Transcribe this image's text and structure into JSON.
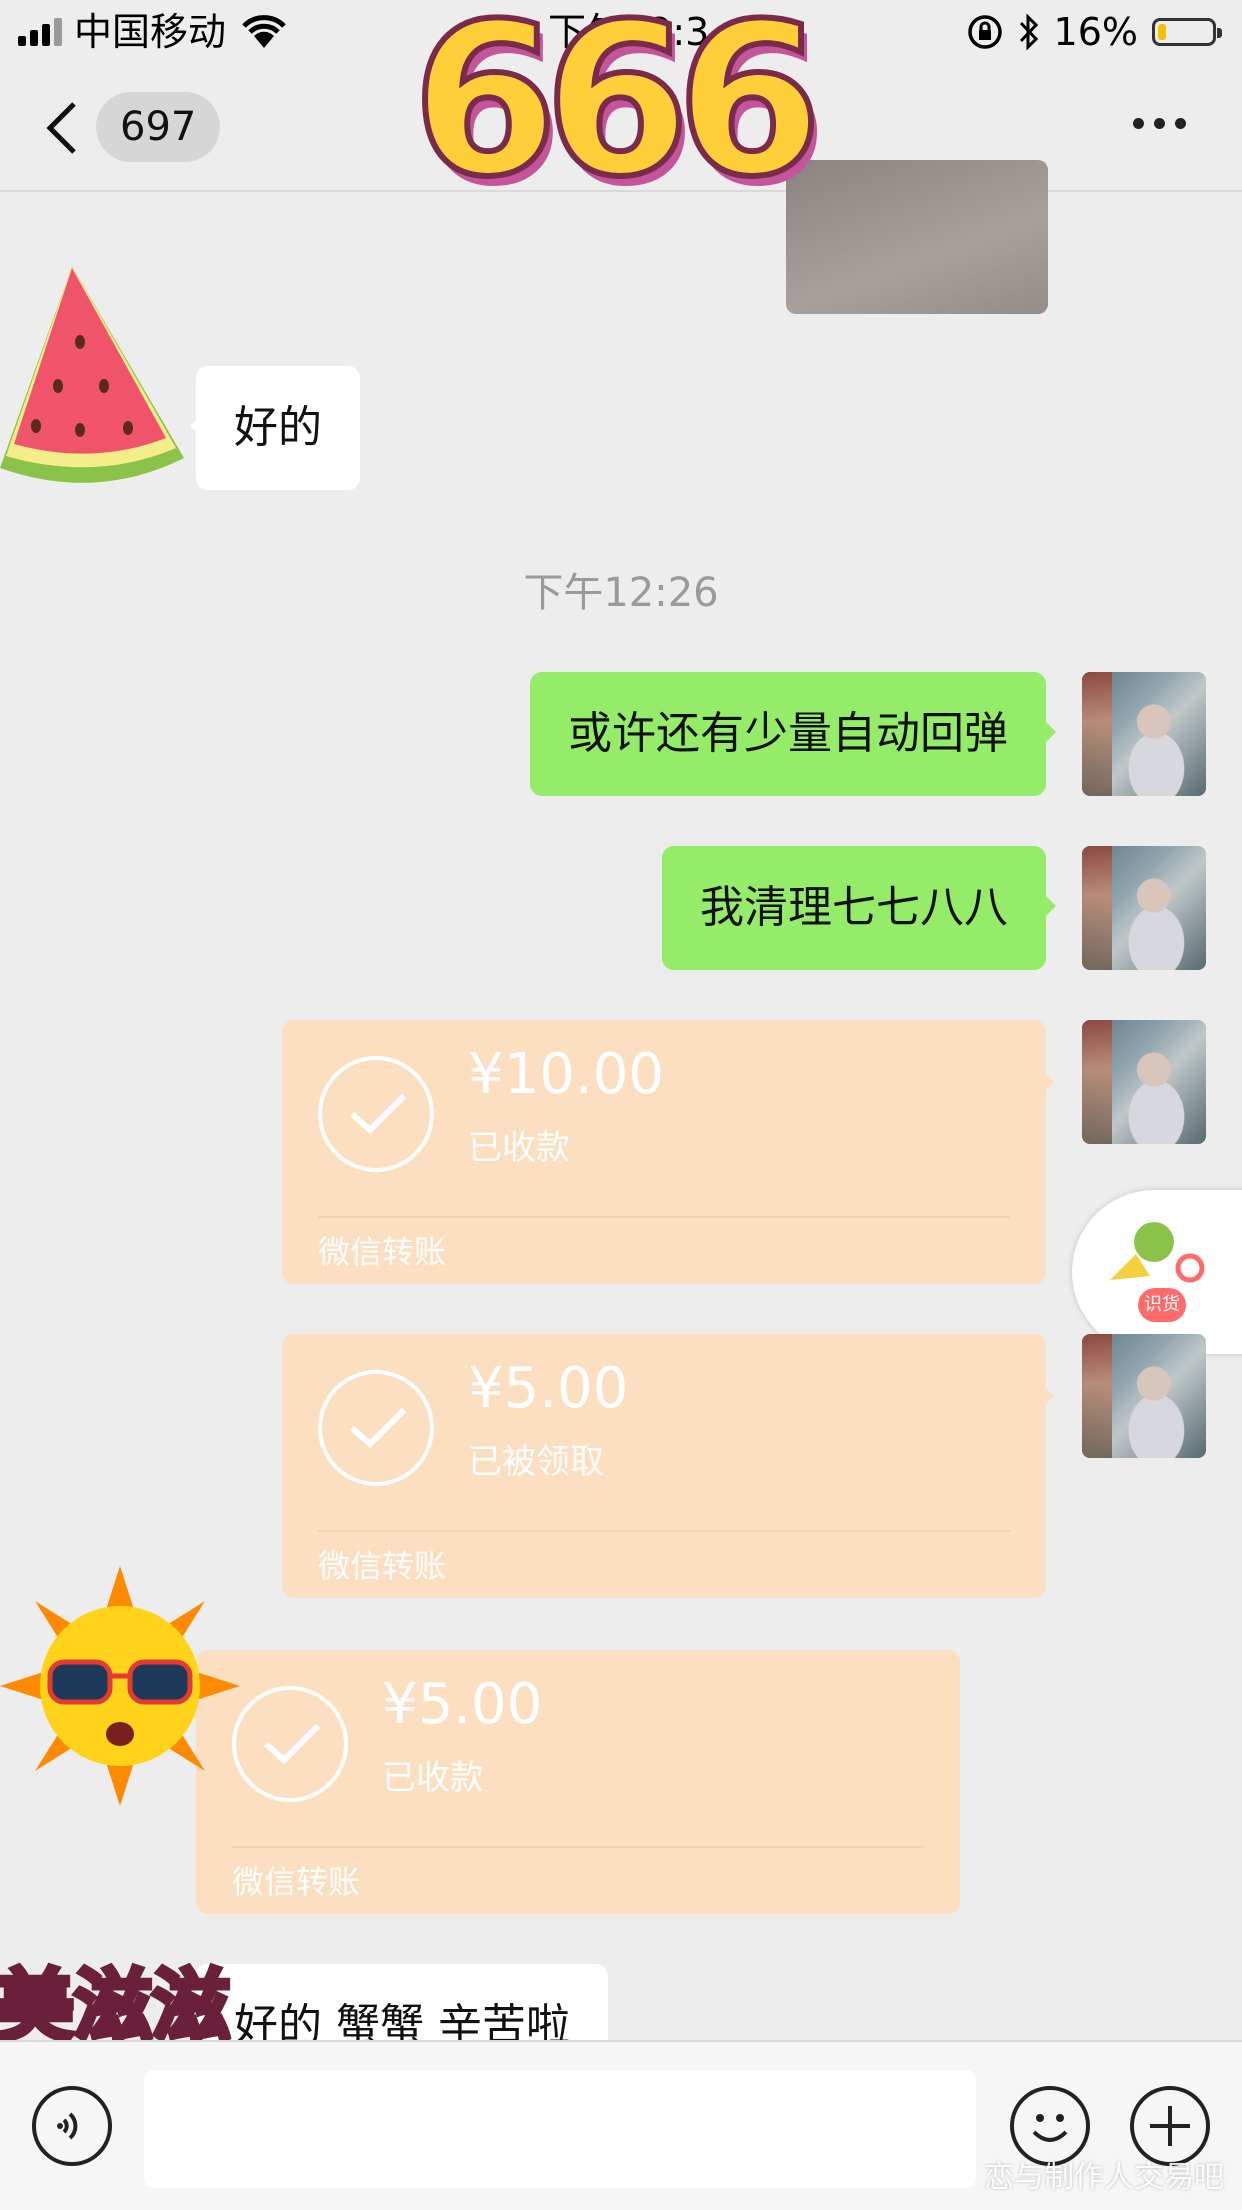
{
  "status_bar": {
    "carrier": "中国移动",
    "time": "下午12:3",
    "battery_text": "16%",
    "battery_level": 0.16
  },
  "nav": {
    "unread_count": "697"
  },
  "messages": {
    "msg1_text": "好的",
    "timestamp": "下午12:26",
    "msg2_text": "或许还有少量自动回弹",
    "msg3_text": "我清理七七八八",
    "msg_last_text": "好的  蟹蟹 辛苦啦"
  },
  "transfers": [
    {
      "amount": "¥10.00",
      "status": "已收款",
      "footer": "微信转账"
    },
    {
      "amount": "¥5.00",
      "status": "已被领取",
      "footer": "微信转账"
    },
    {
      "amount": "¥5.00",
      "status": "已收款",
      "footer": "微信转账"
    }
  ],
  "stickers": {
    "big_text": "666",
    "bottom_text": "美滋滋",
    "fab_badge": "识货"
  },
  "watermark": "恋与制作人交易吧",
  "colors": {
    "background": "#ededed",
    "outgoing_bubble": "#95ec69",
    "incoming_bubble": "#ffffff",
    "transfer_card": "#fcdec1",
    "timestamp": "#9a9a9a"
  },
  "icons": [
    "signal-icon",
    "wifi-icon",
    "lock-rotation-icon",
    "bluetooth-icon",
    "battery-icon",
    "back-arrow-icon",
    "more-icon",
    "check-circle-icon",
    "voice-icon",
    "emoji-icon",
    "plus-icon"
  ]
}
